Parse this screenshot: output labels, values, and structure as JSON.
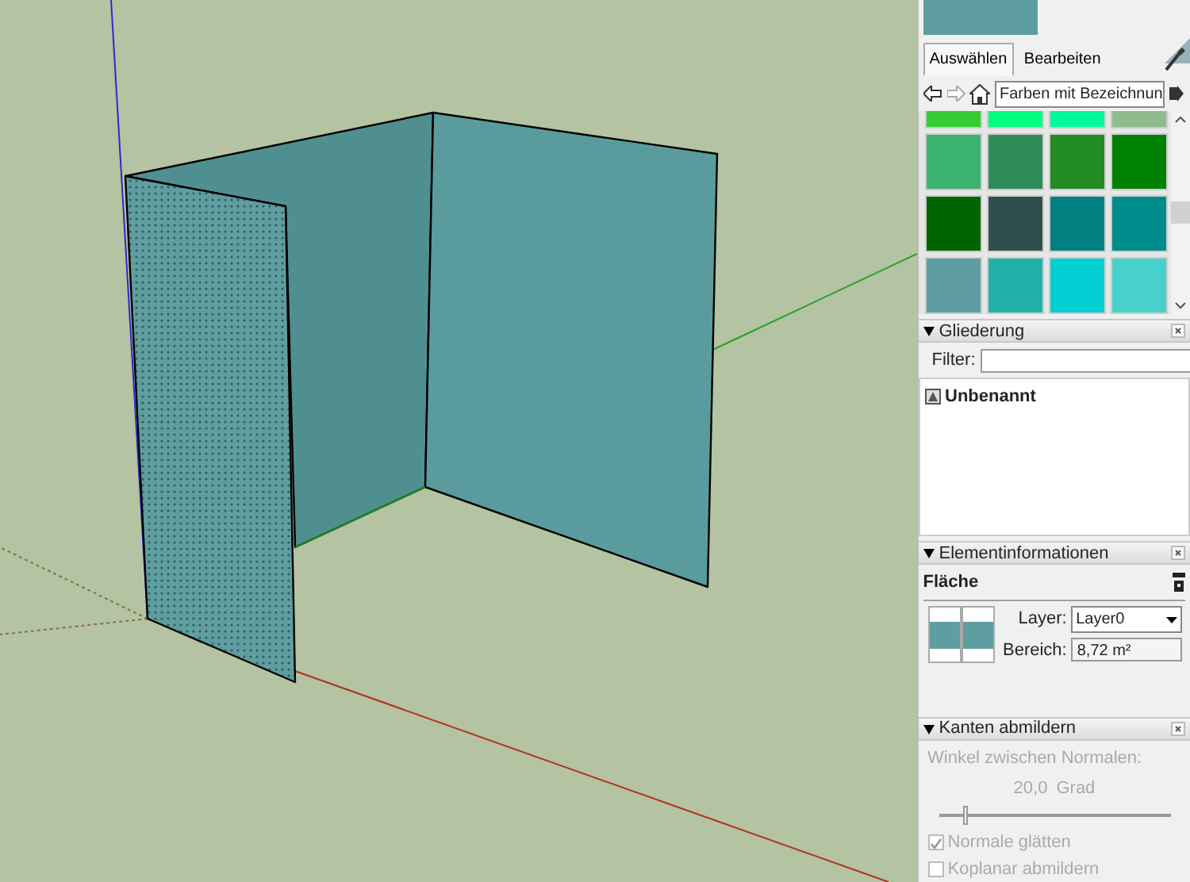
{
  "material_preview": {
    "color": "#5f9ea0"
  },
  "materials": {
    "tabs": [
      {
        "label": "Auswählen",
        "selected": true
      },
      {
        "label": "Bearbeiten",
        "selected": false
      }
    ],
    "library": "Farben mit Bezeichnun",
    "swatches": [
      {
        "color": "#32cd32"
      },
      {
        "color": "#00ff7f"
      },
      {
        "color": "#00fa9a"
      },
      {
        "color": "#8fbc8f"
      },
      {
        "color": "#3cb371"
      },
      {
        "color": "#2e8b57"
      },
      {
        "color": "#228b22"
      },
      {
        "color": "#008000"
      },
      {
        "color": "#006400"
      },
      {
        "color": "#2f4f4f"
      },
      {
        "color": "#008080"
      },
      {
        "color": "#008b8b"
      },
      {
        "color": "#5f9ea0"
      },
      {
        "color": "#20b2aa"
      },
      {
        "color": "#00ced1"
      },
      {
        "color": "#48d1cc"
      }
    ]
  },
  "outliner": {
    "title": "Gliederung",
    "expanded": true,
    "filter_label": "Filter:",
    "items": [
      {
        "label": "Unbenannt"
      }
    ]
  },
  "entity_info": {
    "title": "Elementinformationen",
    "expanded": true,
    "type": "Fläche",
    "layer_label": "Layer:",
    "layer": "Layer0",
    "area_label": "Bereich:",
    "area": "8,72 m²"
  },
  "soften_edges": {
    "title": "Kanten abmildern",
    "expanded": true,
    "angle_label": "Winkel zwischen Normalen:",
    "angle": "20,0",
    "unit": "Grad",
    "level": 0.12,
    "options": [
      {
        "label": "Normale glätten",
        "checked": true,
        "disabled": true
      },
      {
        "label": "Koplanar abmildern",
        "checked": false,
        "disabled": true
      }
    ]
  }
}
